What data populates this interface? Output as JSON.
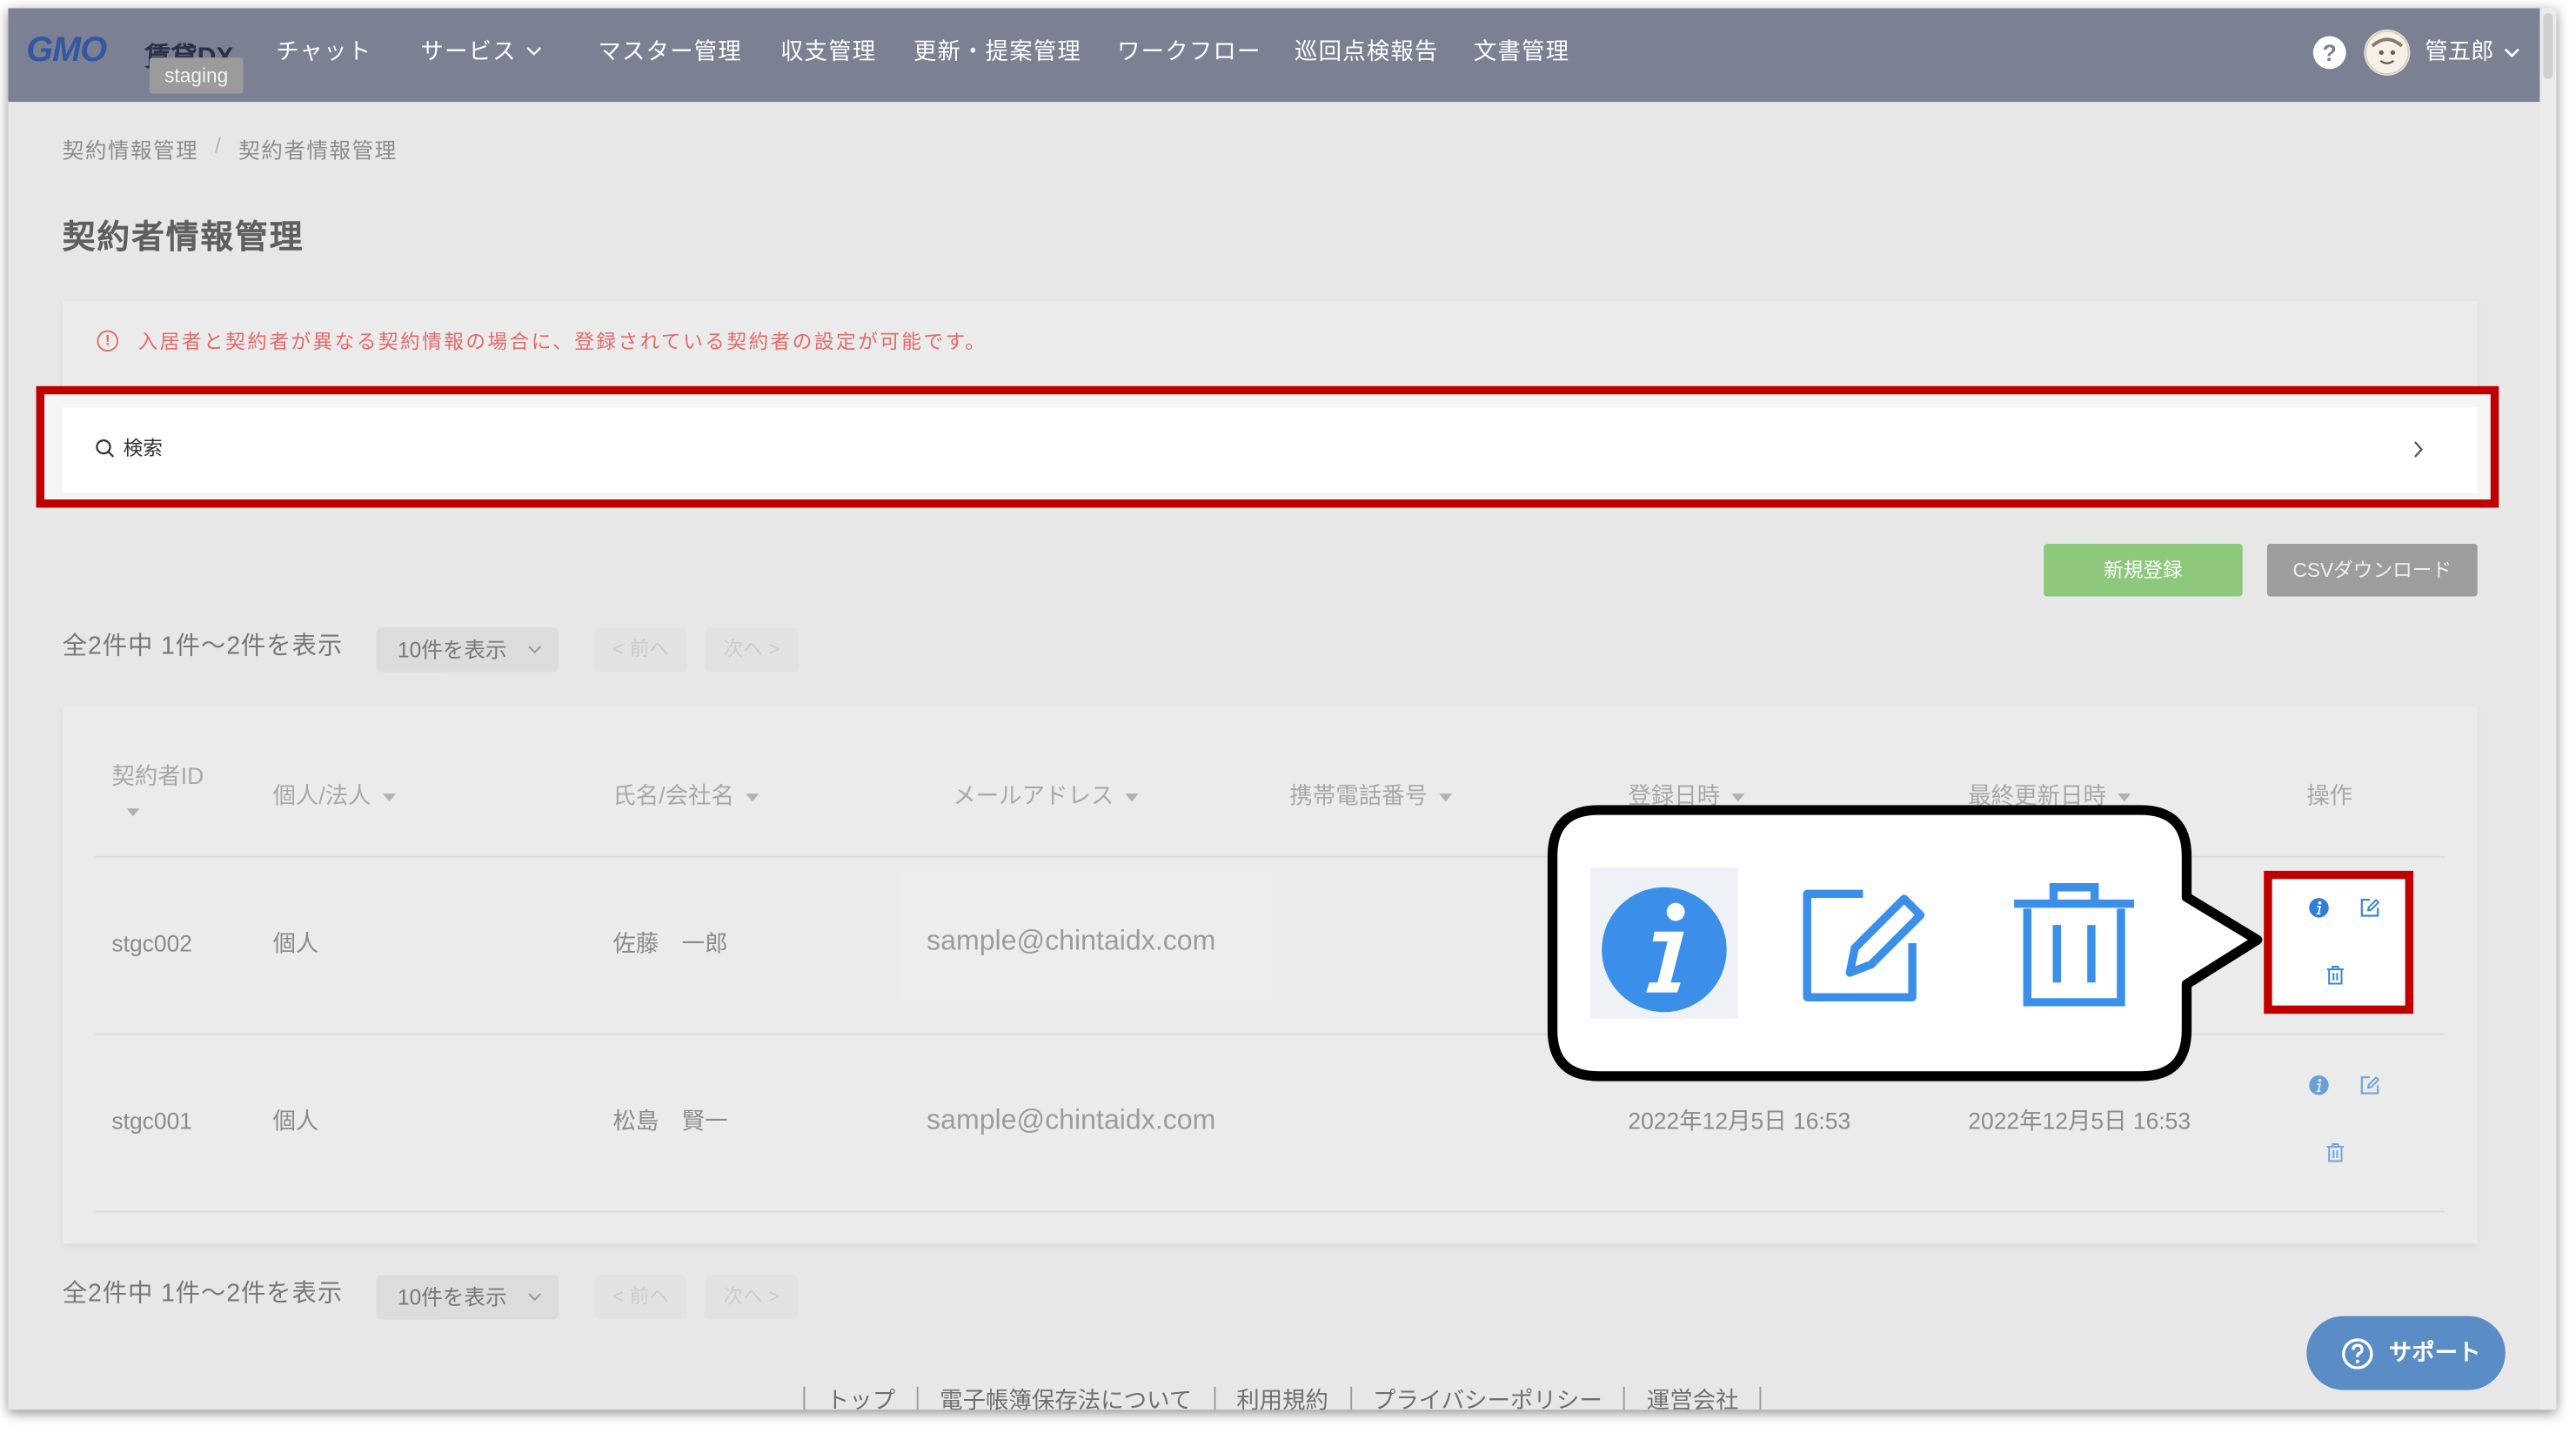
{
  "header": {
    "logo": "GMO",
    "brand": "賃貸DX",
    "env_badge": "staging",
    "nav": [
      {
        "label": "チャット"
      },
      {
        "label": "サービス",
        "icon": "chevron-down-icon"
      },
      {
        "label": "マスター管理"
      },
      {
        "label": "収支管理"
      },
      {
        "label": "更新・提案管理"
      },
      {
        "label": "ワークフロー"
      },
      {
        "label": "巡回点検報告"
      },
      {
        "label": "文書管理"
      }
    ],
    "help_icon": "question-circle-icon",
    "avatar_icon": "avatar",
    "user_name": "管五郎",
    "user_menu_icon": "chevron-down-icon"
  },
  "breadcrumb": {
    "items": [
      "契約情報管理",
      "契約者情報管理"
    ],
    "separator": "/"
  },
  "page_title": "契約者情報管理",
  "alert": {
    "icon": "exclamation-circle-icon",
    "text": "入居者と契約者が異なる契約情報の場合に、登録されている契約者の設定が可能です。"
  },
  "search": {
    "icon": "search-icon",
    "label": "検索",
    "expand_icon": "chevron-right-icon"
  },
  "actions": {
    "new_label": "新規登録",
    "csv_label": "CSVダウンロード"
  },
  "pagination": {
    "summary": "全2件中 1件～2件を表示",
    "page_size": "10件を表示",
    "prev": "< 前へ",
    "next": "次へ >"
  },
  "table": {
    "columns": [
      "契約者ID",
      "個人/法人",
      "氏名/会社名",
      "メールアドレス",
      "携帯電話番号",
      "登録日時",
      "最終更新日時",
      "操作"
    ],
    "rows": [
      {
        "id": "stgc002",
        "type": "個人",
        "name": "佐藤　一郎",
        "email": "sample@chintaidx.com"
      },
      {
        "id": "stgc001",
        "type": "個人",
        "name": "松島　賢一",
        "email": "sample@chintaidx.com",
        "created": "2022年12月5日 16:53",
        "updated": "2022年12月5日 16:53"
      }
    ],
    "row_action_icons": [
      "info-icon",
      "edit-icon",
      "trash-icon"
    ]
  },
  "callout": {
    "icons": [
      "info-icon",
      "edit-icon",
      "trash-icon"
    ]
  },
  "support": {
    "icon": "question-circle-icon",
    "label": "サポート"
  },
  "footer": {
    "links": [
      "トップ",
      "電子帳簿保存法について",
      "利用規約",
      "プライバシーポリシー",
      "運営会社"
    ]
  },
  "colors": {
    "navbar": "#7b8192",
    "highlight_red": "#c00000",
    "alert_red": "#e36a6a",
    "accent_blue": "#3b8fe8",
    "new_button": "#8dc87c",
    "csv_button": "#9d9d9d",
    "support_button": "#5a8cc6"
  }
}
